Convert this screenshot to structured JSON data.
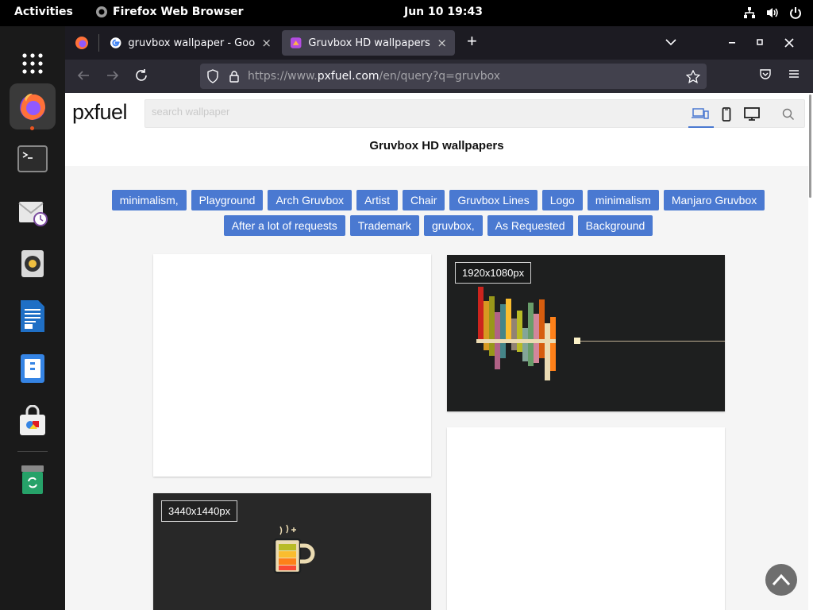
{
  "topbar": {
    "activities": "Activities",
    "app_name": "Firefox Web Browser",
    "clock": "Jun 10  19:43"
  },
  "dock": {
    "items": [
      "firefox",
      "terminal",
      "mail-clock",
      "rhythmbox",
      "writer",
      "files",
      "software",
      "trash"
    ]
  },
  "browser": {
    "tabs": [
      {
        "title": "gruvbox wallpaper - Google",
        "close": "×"
      },
      {
        "title": "Gruvbox HD wallpapers | Px",
        "close": "×"
      }
    ],
    "new_tab": "+",
    "url": {
      "prefix": "https://www.",
      "domain": "pxfuel.com",
      "path": "/en/query?q=gruvbox"
    }
  },
  "page": {
    "logo": "pxfuel",
    "search_placeholder": "search wallpaper",
    "title": "Gruvbox HD wallpapers",
    "tags": [
      "minimalism,",
      "Playground",
      "Arch Gruvbox",
      "Artist",
      "Chair",
      "Gruvbox Lines",
      "Logo",
      "minimalism",
      "Manjaro Gruvbox",
      "After a lot of requests",
      "Trademark",
      "gruvbox,",
      "As Requested",
      "Background"
    ],
    "cards": [
      {
        "resolution": ""
      },
      {
        "resolution": "1920x1080px"
      },
      {
        "resolution": ""
      },
      {
        "resolution": "3440x1440px"
      }
    ]
  },
  "colors": {
    "accent": "#4a79d1",
    "chrome": "#2b2a33",
    "tabstrip": "#1c1b22"
  }
}
